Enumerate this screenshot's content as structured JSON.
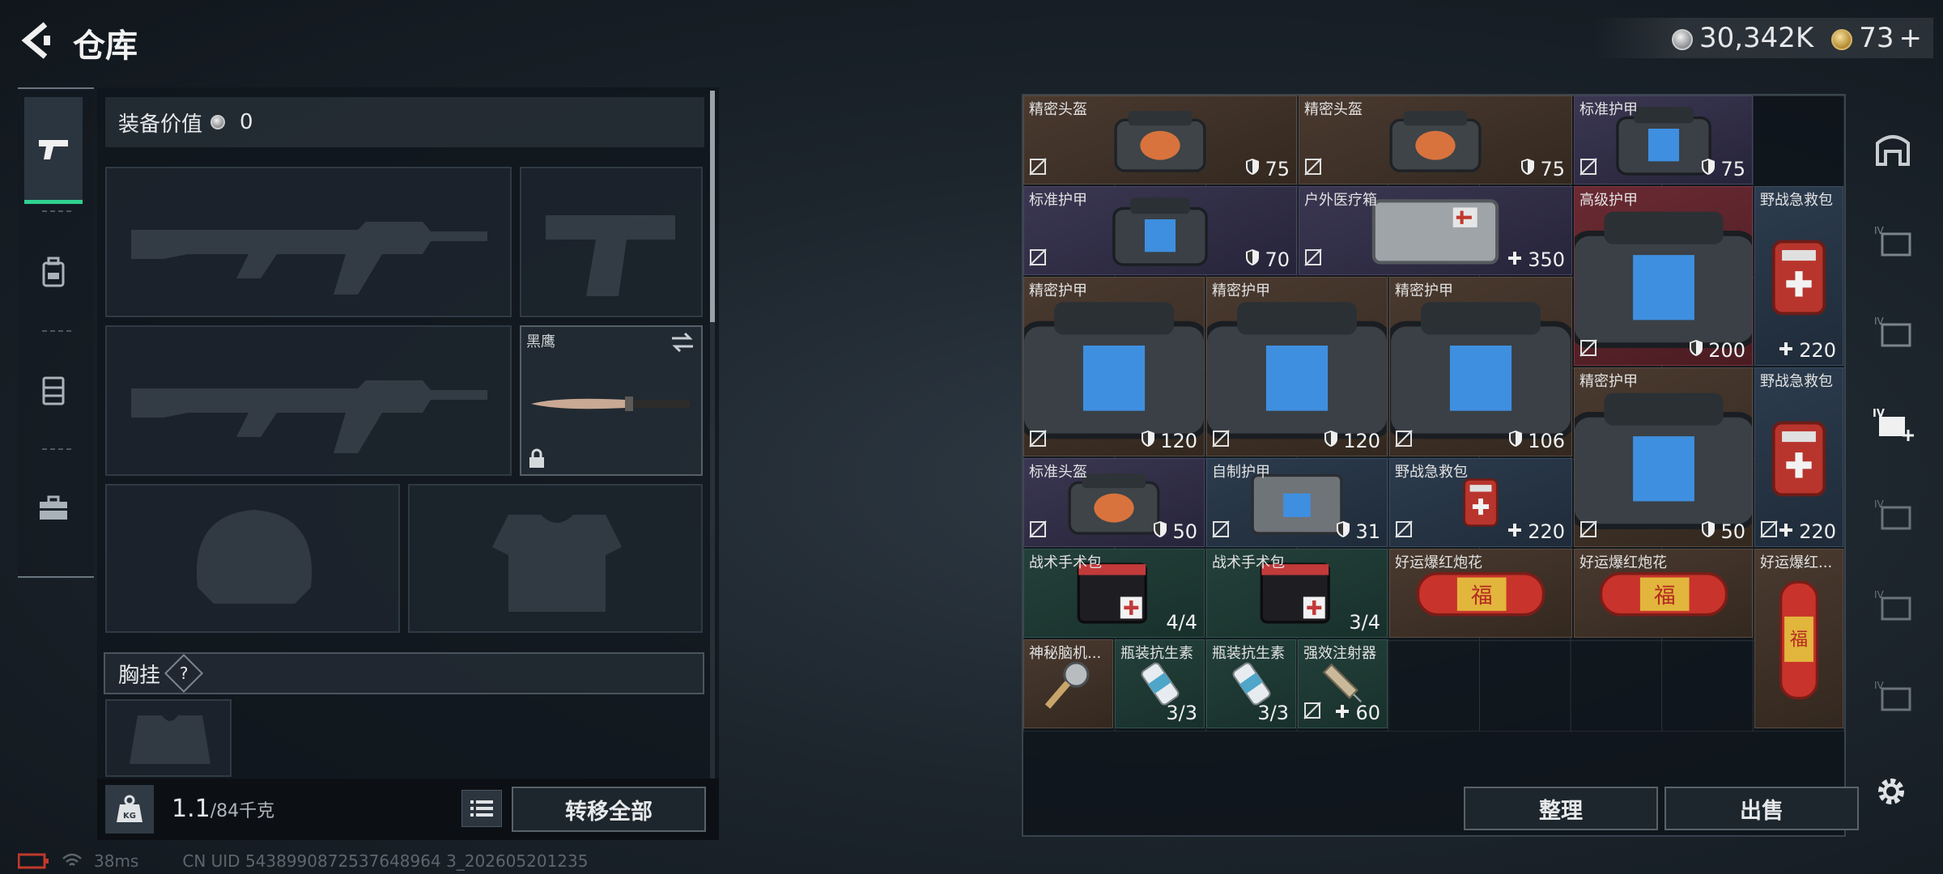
{
  "header": {
    "title": "仓库"
  },
  "currency": {
    "silver": "30,342K",
    "gold": "73",
    "plus": "+"
  },
  "equipment": {
    "value_label": "装备价值",
    "value": "0",
    "melee_label": "黑鹰",
    "chest_label": "胸挂",
    "help": "?",
    "weight_current": "1.1",
    "weight_max": "/84千克",
    "transfer_all": "转移全部"
  },
  "inventory": {
    "items": [
      {
        "name": "精密头盔",
        "value": "75",
        "icon": "shield",
        "color": "brown",
        "art": "helmet-orange"
      },
      {
        "name": "精密头盔",
        "value": "75",
        "icon": "shield",
        "color": "brown",
        "art": "helmet-orange"
      },
      {
        "name": "标准护甲",
        "value": "75",
        "icon": "shield",
        "color": "purple",
        "art": "vest-blue"
      },
      {
        "name": "标准护甲",
        "value": "70",
        "icon": "shield",
        "color": "purple",
        "art": "vest-blue"
      },
      {
        "name": "户外医疗箱",
        "value": "350",
        "icon": "plus",
        "color": "purple",
        "art": "medbox"
      },
      {
        "name": "高级护甲",
        "value": "200",
        "icon": "shield",
        "color": "red",
        "art": "vest-blue"
      },
      {
        "name": "野战急救包",
        "value": "220",
        "icon": "plus",
        "color": "blue",
        "art": "firstaid"
      },
      {
        "name": "精密护甲",
        "value": "120",
        "icon": "shield",
        "color": "brown",
        "art": "vest-blue"
      },
      {
        "name": "精密护甲",
        "value": "120",
        "icon": "shield",
        "color": "brown",
        "art": "vest-blue"
      },
      {
        "name": "精密护甲",
        "value": "106",
        "icon": "shield",
        "color": "brown",
        "art": "vest-blue"
      },
      {
        "name": "精密护甲",
        "value": "50",
        "icon": "shield",
        "color": "brown",
        "art": "vest-blue"
      },
      {
        "name": "野战急救包",
        "value": "220",
        "icon": "plus",
        "color": "blue",
        "art": "firstaid"
      },
      {
        "name": "标准头盔",
        "value": "50",
        "icon": "shield",
        "color": "purple",
        "art": "helmet-orange"
      },
      {
        "name": "自制护甲",
        "value": "31",
        "icon": "shield",
        "color": "blue",
        "art": "vest-gray"
      },
      {
        "name": "野战急救包",
        "value": "220",
        "icon": "plus",
        "color": "blue",
        "art": "firstaid"
      },
      {
        "name": "战术手术包",
        "value": "4/4",
        "icon": "",
        "color": "green",
        "art": "surgkit"
      },
      {
        "name": "战术手术包",
        "value": "3/4",
        "icon": "",
        "color": "green",
        "art": "surgkit"
      },
      {
        "name": "好运爆红炮花",
        "value": "",
        "icon": "",
        "color": "brown",
        "art": "firecracker"
      },
      {
        "name": "好运爆红炮花",
        "value": "",
        "icon": "",
        "color": "brown",
        "art": "firecracker"
      },
      {
        "name": "好运爆红...",
        "value": "",
        "icon": "",
        "color": "brown",
        "art": "firecracker-v"
      },
      {
        "name": "神秘脑机...",
        "value": "",
        "icon": "",
        "color": "brown",
        "art": "watch"
      },
      {
        "name": "瓶装抗生素",
        "value": "3/3",
        "icon": "",
        "color": "green",
        "art": "bottle"
      },
      {
        "name": "瓶装抗生素",
        "value": "3/3",
        "icon": "",
        "color": "green",
        "art": "bottle"
      },
      {
        "name": "强效注射器",
        "value": "60",
        "icon": "plus",
        "color": "green",
        "art": "syringe"
      }
    ],
    "sort": "整理",
    "sell": "出售"
  },
  "status": {
    "ping": "38ms",
    "uid": "CN UID 5438990872537648964 3_202605201235"
  },
  "icons": [
    "back-icon",
    "pistol-icon",
    "backpack-icon",
    "vest-icon",
    "briefcase-icon",
    "swap-icon",
    "lock-icon",
    "kg-icon",
    "list-icon",
    "shield-icon",
    "plus-icon",
    "no-trade-icon",
    "storage-icon",
    "gear-icon",
    "battery-icon",
    "wifi-icon"
  ],
  "colors": {
    "accent": "#2fd28f",
    "brown": "#4a3a30",
    "purple": "#3b3752",
    "red": "#6a2a32",
    "blue": "#2c3c4e",
    "green": "#24403a"
  }
}
